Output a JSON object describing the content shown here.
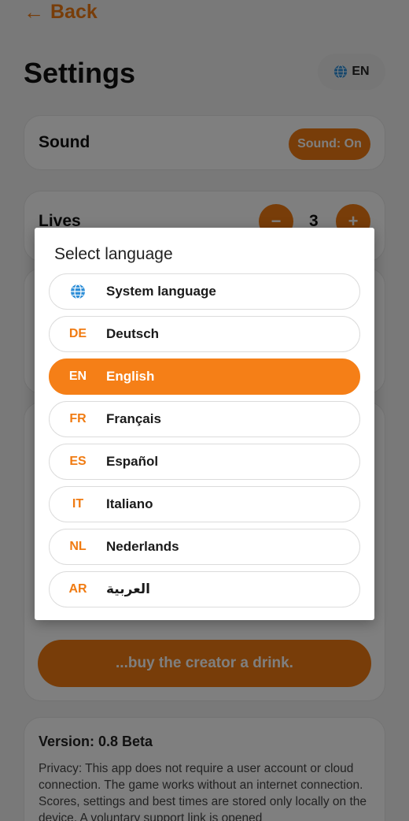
{
  "header": {
    "back_label": "Back",
    "title": "Settings",
    "language_pill": "EN"
  },
  "sound": {
    "label": "Sound",
    "button": "Sound: On"
  },
  "lives": {
    "label": "Lives",
    "minus": "−",
    "value": "3",
    "plus": "+"
  },
  "support": {
    "drink_button": "...buy the creator a drink."
  },
  "version": {
    "title": "Version: 0.8 Beta",
    "privacy": "Privacy: This app does not require a user account or cloud connection. The game works without an internet connection. Scores, settings and best times are stored only locally on the device. A voluntary support link is opened"
  },
  "dialog": {
    "title": "Select language",
    "items": [
      {
        "code": "",
        "icon": "globe-icon",
        "name": "System language",
        "selected": false
      },
      {
        "code": "DE",
        "name": "Deutsch",
        "selected": false
      },
      {
        "code": "EN",
        "name": "English",
        "selected": true
      },
      {
        "code": "FR",
        "name": "Français",
        "selected": false
      },
      {
        "code": "ES",
        "name": "Español",
        "selected": false
      },
      {
        "code": "IT",
        "name": "Italiano",
        "selected": false
      },
      {
        "code": "NL",
        "name": "Nederlands",
        "selected": false
      },
      {
        "code": "AR",
        "name": "العربية",
        "selected": false
      }
    ]
  },
  "colors": {
    "accent": "#f07b12",
    "selected": "#f57f17",
    "overlay": "rgba(0,0,0,0.5)"
  }
}
